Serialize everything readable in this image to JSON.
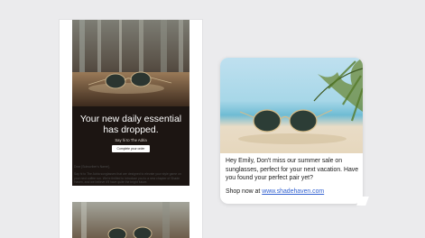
{
  "email": {
    "headline": "Your new daily essential has dropped.",
    "subline": "Say hi to The Adria",
    "cta_label": "Complete your order",
    "greeting": "Dear [Subscriber's Name],",
    "body": "Say hi to The Adria sunglasses that are designed to elevate your style game on your next coffee run. We're thrilled to introduce you to a new chapter of Shade Haven, and we believe it'll have quite the bright future."
  },
  "message": {
    "text": "Hey Emily, Don't miss our summer sale on sunglasses, perfect for your next vacation. Have you found your perfect pair yet?",
    "shop_prefix": "Shop now at",
    "link": "www.shadehaven.com"
  },
  "icons": {
    "hero_image": "sunglasses-on-cafe-table-photo",
    "message_image": "sunglasses-on-beach-photo"
  },
  "colors": {
    "background": "#ebebed",
    "hero_dark": "#1c1512",
    "link": "#2f5fd0"
  }
}
